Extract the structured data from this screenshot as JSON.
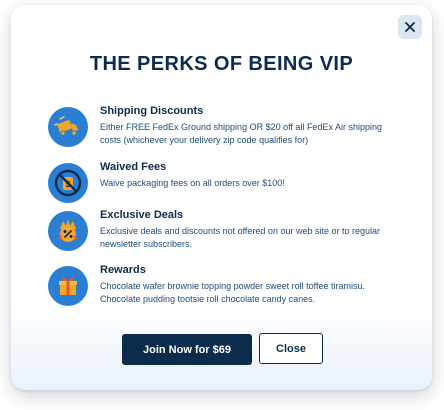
{
  "modal": {
    "title": "THE PERKS OF BEING VIP",
    "close_icon": "close-icon",
    "perks": [
      {
        "icon": "shipping-truck-icon",
        "title": "Shipping Discounts",
        "description": "Either FREE FedEx Ground shipping OR $20 off all FedEx Air shipping costs (whichever your delivery zip code qualifies for)"
      },
      {
        "icon": "no-fees-icon",
        "title": "Waived Fees",
        "description": "Waive packaging fees on all orders over $100!"
      },
      {
        "icon": "discount-tag-icon",
        "title": "Exclusive Deals",
        "description": "Exclusive deals and discounts not offered on our web site or to regular newsletter subscribers."
      },
      {
        "icon": "gift-icon",
        "title": "Rewards",
        "description": "Chocolate wafer brownie topping powder sweet roll toffee tiramisu. Chocolate pudding tootsie roll chocolate candy canes."
      }
    ],
    "buttons": {
      "join_label": "Join Now for $69",
      "close_label": "Close"
    }
  },
  "colors": {
    "primary_navy": "#0c2c4e",
    "icon_blue": "#2b7fd3",
    "accent_orange": "#f4a52a",
    "close_bg": "#dbe6f3"
  }
}
